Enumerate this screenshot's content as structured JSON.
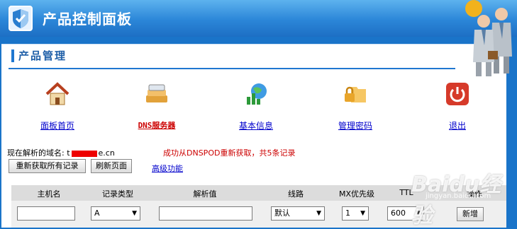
{
  "header": {
    "title": "产品控制面板"
  },
  "section": {
    "title": "产品管理"
  },
  "nav": [
    {
      "label": "面板首页"
    },
    {
      "label": "DNS服务器"
    },
    {
      "label": "基本信息"
    },
    {
      "label": "管理密码"
    },
    {
      "label": "退出"
    }
  ],
  "domain": {
    "prefix": "现在解析的域名: t",
    "suffix": "e.cn"
  },
  "status_message": "成功从DNSPOD重新获取，共5条记录",
  "buttons": {
    "refetch": "重新获取所有记录",
    "refresh": "刷新页面",
    "advanced": "高级功能"
  },
  "table": {
    "headers": [
      "主机名",
      "记录类型",
      "解析值",
      "线路",
      "MX优先级",
      "TTL",
      "操作"
    ],
    "new_row": {
      "host": "",
      "type": "A",
      "value": "",
      "line": "默认",
      "mx": "1",
      "ttl": "600",
      "action": "新增"
    }
  },
  "watermark": {
    "text": "Baidu经验",
    "sub": "jingyan.baidu.com"
  },
  "colors": {
    "header_blue": "#2b86d8",
    "link_blue": "#0000cc",
    "alert_red": "#cc0000"
  }
}
